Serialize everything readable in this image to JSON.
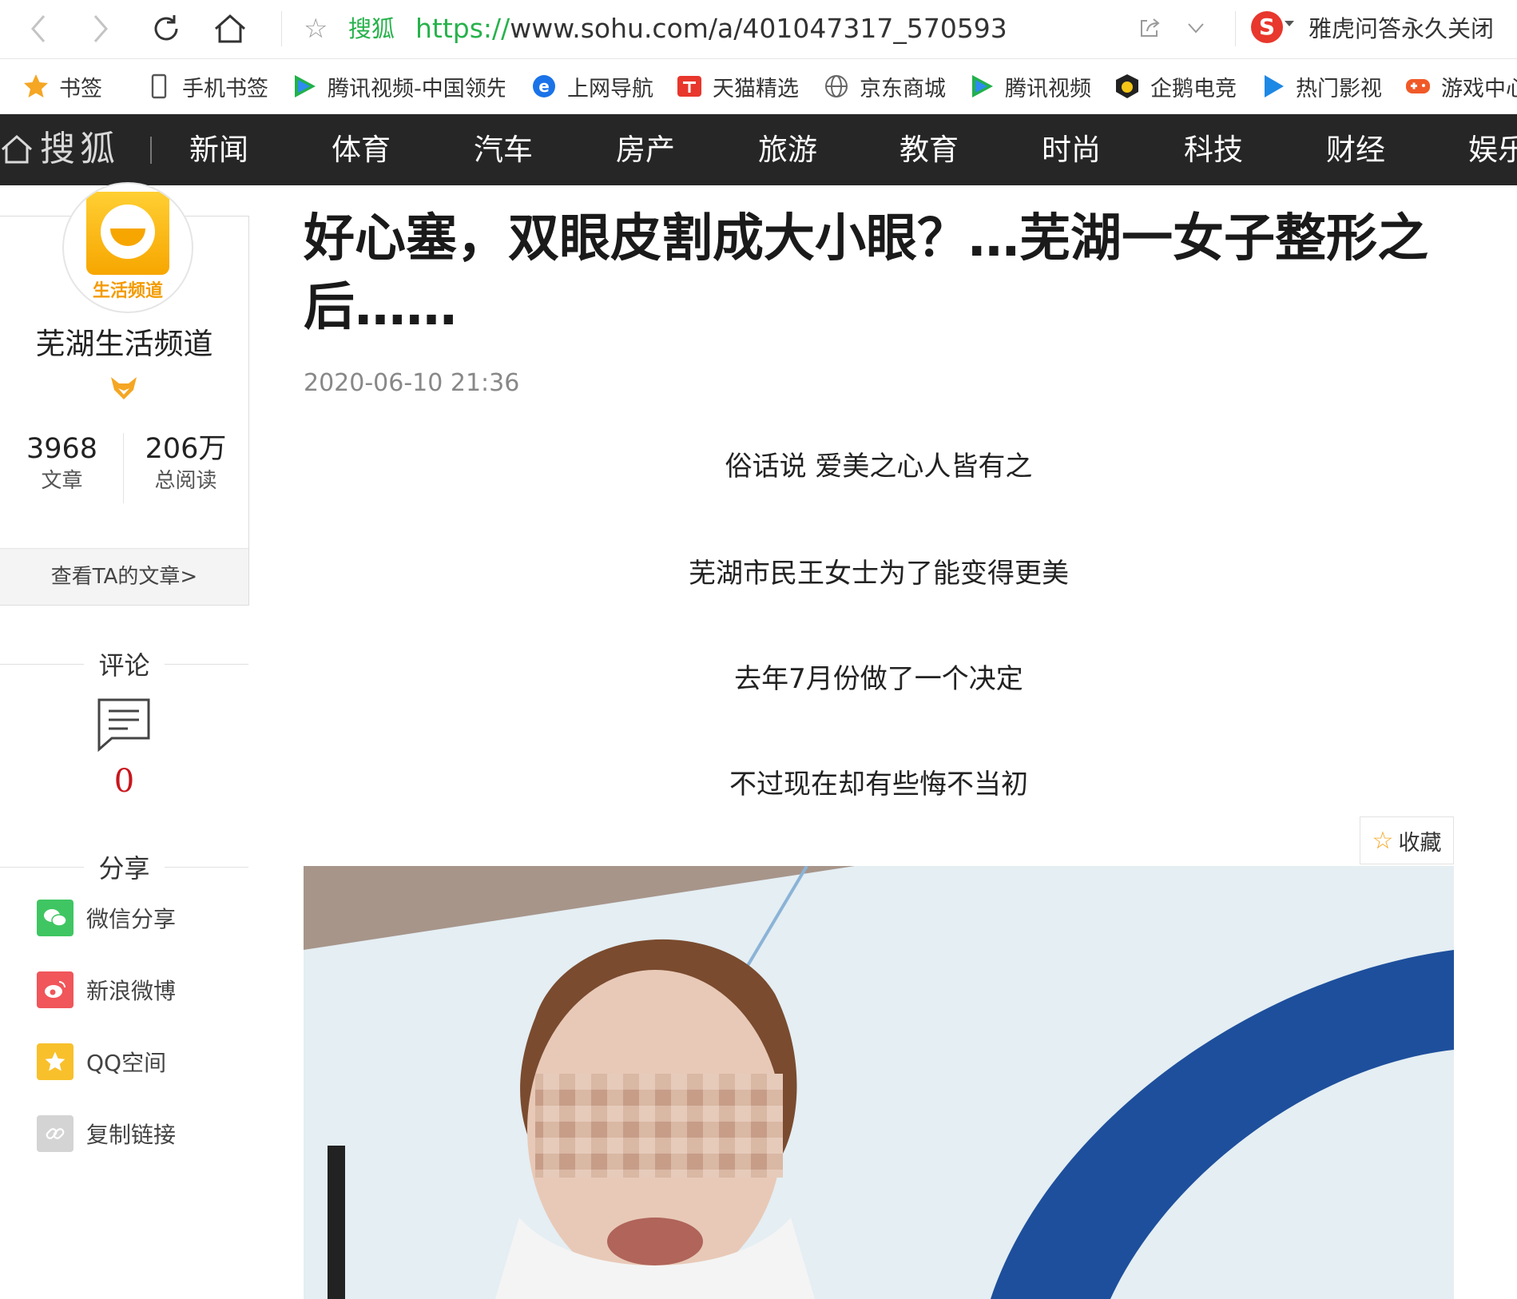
{
  "browser": {
    "site_tag": "搜狐",
    "url_protocol": "https://",
    "url_rest": "www.sohu.com/a/401047317_570593",
    "search_engine_text": "雅虎问答永久关闭",
    "icons": {
      "back": "chevron-left-icon",
      "forward": "chevron-right-icon",
      "reload": "reload-icon",
      "home": "home-icon",
      "favorite": "star-icon",
      "share": "share-icon",
      "dropdown": "chevron-down-icon"
    }
  },
  "bookmarks": [
    {
      "label": "书签",
      "icon": "star-icon",
      "color": "#f5a623"
    },
    {
      "label": "手机书签",
      "icon": "phone-icon",
      "color": "#555555"
    },
    {
      "label": "腾讯视频-中国领先",
      "icon": "tencent-video-icon",
      "color": "#2e8bf0"
    },
    {
      "label": "上网导航",
      "icon": "ie-icon",
      "color": "#1a73e8"
    },
    {
      "label": "天猫精选",
      "icon": "tmall-icon",
      "color": "#e8372c"
    },
    {
      "label": "京东商城",
      "icon": "globe-icon",
      "color": "#666666"
    },
    {
      "label": "腾讯视频",
      "icon": "tencent-video-icon",
      "color": "#2e8bf0"
    },
    {
      "label": "企鹅电竞",
      "icon": "penguin-esports-icon",
      "color": "#222222"
    },
    {
      "label": "热门影视",
      "icon": "play-icon",
      "color": "#1e88e5"
    },
    {
      "label": "游戏中心",
      "icon": "gamepad-icon",
      "color": "#f05a28"
    }
  ],
  "site_nav": {
    "logo": "搜狐",
    "links": [
      "新闻",
      "体育",
      "汽车",
      "房产",
      "旅游",
      "教育",
      "时尚",
      "科技",
      "财经",
      "娱乐"
    ]
  },
  "author": {
    "avatar_text": "生活频道",
    "name": "芜湖生活频道",
    "articles_count": "3968",
    "articles_label": "文章",
    "reads_count": "206万",
    "reads_label": "总阅读",
    "view_link": "查看TA的文章>"
  },
  "comments": {
    "heading": "评论",
    "count": "0"
  },
  "share": {
    "heading": "分享",
    "items": [
      {
        "label": "微信分享",
        "icon": "wechat-icon",
        "color": "#3fc662"
      },
      {
        "label": "新浪微博",
        "icon": "weibo-icon",
        "color": "#f0565a"
      },
      {
        "label": "QQ空间",
        "icon": "qzone-icon",
        "color": "#f8c02b"
      },
      {
        "label": "复制链接",
        "icon": "link-icon",
        "color": "#cfcfcf"
      }
    ]
  },
  "article": {
    "title": "好心塞，双眼皮割成大小眼？…芜湖一女子整形之后……",
    "date": "2020-06-10 21:36",
    "paragraphs": [
      "俗话说 爱美之心人皆有之",
      "芜湖市民王女士为了能变得更美",
      "去年7月份做了一个决定",
      "不过现在却有些悔不当初"
    ],
    "favorite_label": "收藏"
  }
}
